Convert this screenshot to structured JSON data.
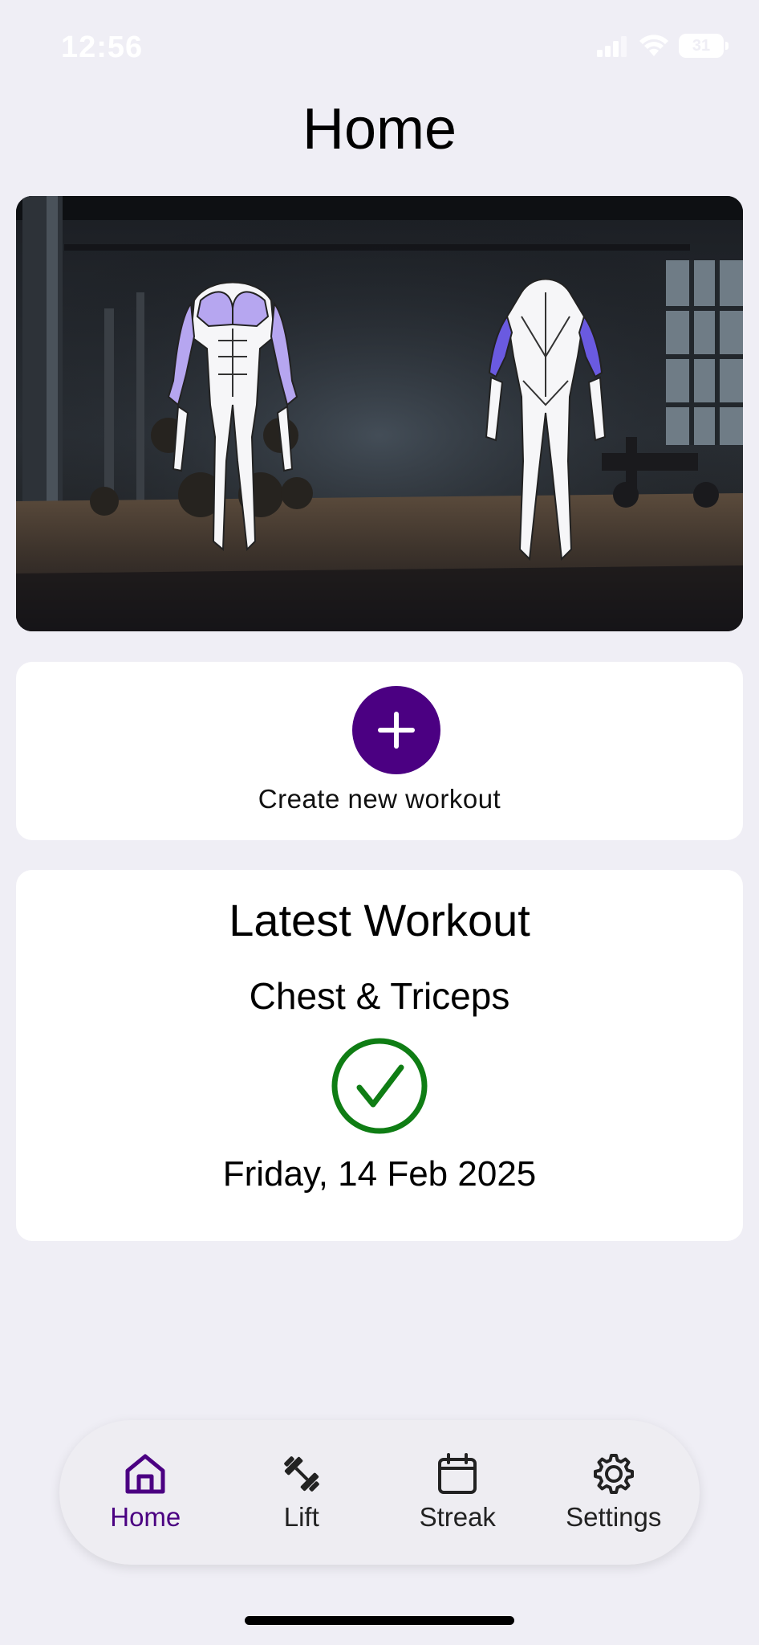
{
  "status_bar": {
    "time": "12:56",
    "battery": "31",
    "icons": [
      "signal-icon",
      "wifi-icon",
      "battery-icon"
    ]
  },
  "page": {
    "title": "Home"
  },
  "hero": {
    "image": "gym-muscle-map",
    "highlight_front_color": "#b6a6f0",
    "highlight_back_color": "#6a5ae0"
  },
  "create": {
    "button_icon": "plus-icon",
    "label": "Create new workout"
  },
  "latest": {
    "title": "Latest Workout",
    "name": "Chest & Triceps",
    "status_icon": "checkmark-circle-icon",
    "date": "Friday, 14 Feb 2025"
  },
  "tabs": [
    {
      "label": "Home",
      "icon": "home-icon",
      "active": true
    },
    {
      "label": "Lift",
      "icon": "dumbbell-icon",
      "active": false
    },
    {
      "label": "Streak",
      "icon": "calendar-icon",
      "active": false
    },
    {
      "label": "Settings",
      "icon": "gear-icon",
      "active": false
    }
  ],
  "colors": {
    "accent": "#4b0082",
    "success": "#0f7d14",
    "background": "#efeef5",
    "card": "#ffffff"
  }
}
